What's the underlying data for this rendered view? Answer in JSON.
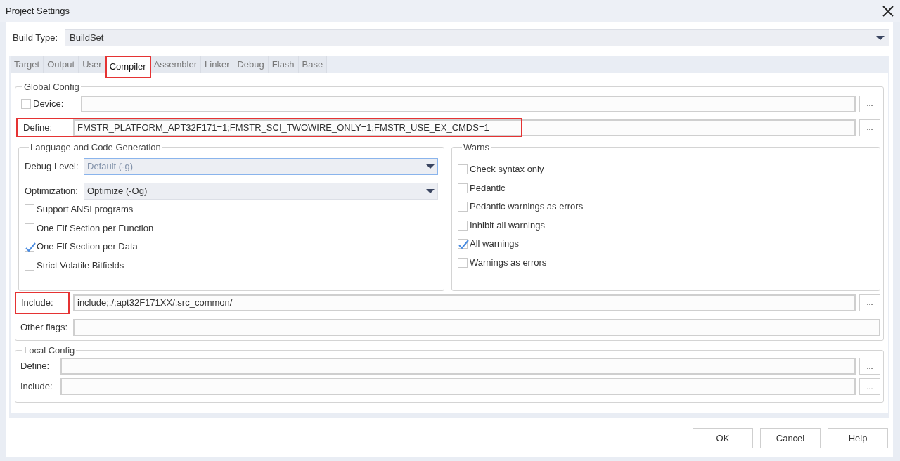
{
  "window": {
    "title": "Project Settings"
  },
  "build_type": {
    "label": "Build Type:",
    "value": "BuildSet"
  },
  "tabs": [
    {
      "label": "Target",
      "selected": false,
      "highlighted": false
    },
    {
      "label": "Output",
      "selected": false,
      "highlighted": false
    },
    {
      "label": "User",
      "selected": false,
      "highlighted": false
    },
    {
      "label": "Compiler",
      "selected": true,
      "highlighted": true
    },
    {
      "label": "Assembler",
      "selected": false,
      "highlighted": false
    },
    {
      "label": "Linker",
      "selected": false,
      "highlighted": false
    },
    {
      "label": "Debug",
      "selected": false,
      "highlighted": false
    },
    {
      "label": "Flash",
      "selected": false,
      "highlighted": false
    },
    {
      "label": "Base",
      "selected": false,
      "highlighted": false
    }
  ],
  "global_config": {
    "title": "Global Config",
    "device": {
      "label": "Device:",
      "checked": false,
      "browse": "..."
    },
    "define": {
      "label": "Define:",
      "value": "FMSTR_PLATFORM_APT32F171=1;FMSTR_SCI_TWOWIRE_ONLY=1;FMSTR_USE_EX_CMDS=1",
      "browse": "...",
      "highlighted": true
    },
    "language": {
      "title": "Language and Code Generation",
      "selects": [
        {
          "label": "Debug Level:",
          "value": "Default (-g)",
          "focused": true
        },
        {
          "label": "Optimization:",
          "value": "Optimize (-Og)",
          "focused": false
        }
      ],
      "options": [
        {
          "label": "Support ANSI programs",
          "checked": false
        },
        {
          "label": "One Elf Section per Function",
          "checked": false
        },
        {
          "label": "One Elf Section per Data",
          "checked": true
        },
        {
          "label": "Strict Volatile Bitfields",
          "checked": false
        }
      ]
    },
    "warns": {
      "title": "Warns",
      "options": [
        {
          "label": "Check syntax only",
          "checked": false
        },
        {
          "label": "Pedantic",
          "checked": false
        },
        {
          "label": "Pedantic warnings as errors",
          "checked": false
        },
        {
          "label": "Inhibit all warnings",
          "checked": false
        },
        {
          "label": "All warnings",
          "checked": true
        },
        {
          "label": "Warnings as errors",
          "checked": false
        }
      ]
    },
    "include": {
      "label": "Include:",
      "value": "include;./;apt32F171XX/;src_common/",
      "browse": "...",
      "highlighted": true
    },
    "other_flags": {
      "label": "Other flags:"
    }
  },
  "local_config": {
    "title": "Local Config",
    "define": {
      "label": "Define:",
      "browse": "..."
    },
    "include": {
      "label": "Include:",
      "browse": "..."
    }
  },
  "buttons": [
    "OK",
    "Cancel",
    "Help"
  ]
}
